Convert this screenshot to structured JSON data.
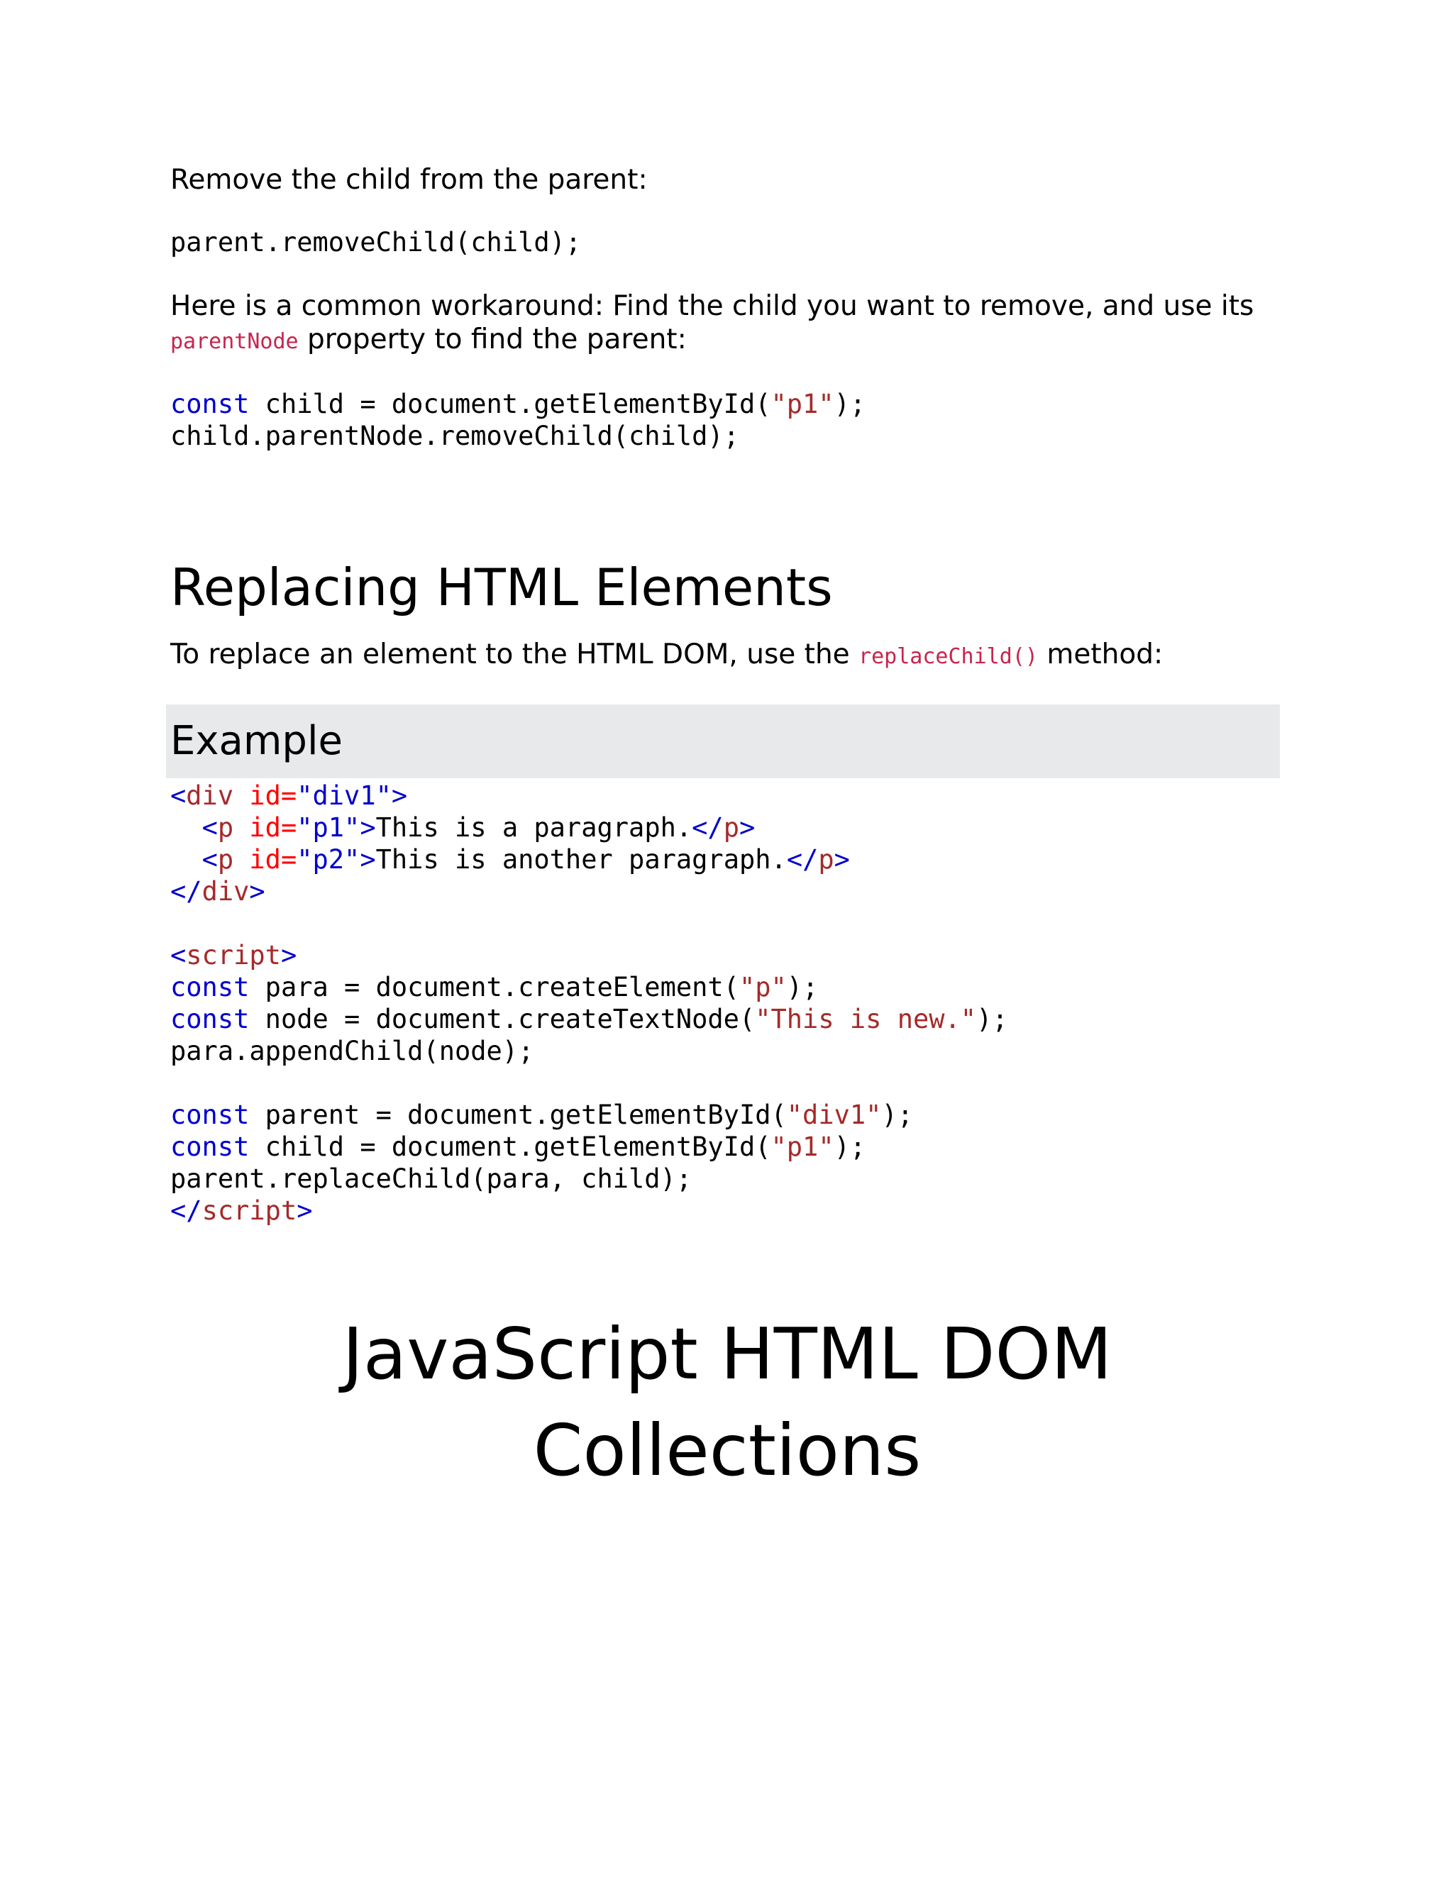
{
  "intro": {
    "remove_text": "Remove the child from the parent:",
    "remove_code": "parent.removeChild(child);",
    "workaround_before": "Here is a common workaround: Find the child you want to remove, and use its ",
    "workaround_code": "parentNode",
    "workaround_after": " property to find the parent:",
    "snippet": {
      "line1_kw": "const",
      "line1_mid": " child = document.getElementById(",
      "line1_str": "\"p1\"",
      "line1_end": ");",
      "line2": "child.parentNode.removeChild(child);"
    }
  },
  "section": {
    "heading": "Replacing HTML Elements",
    "desc_before": "To replace an element to the HTML DOM, use the ",
    "desc_code": "replaceChild()",
    "desc_after": " method:"
  },
  "example": {
    "title": "Example",
    "html_lines": [
      {
        "indent": "",
        "open": "<",
        "tag": "div",
        "attr": " id=",
        "val": "\"div1\"",
        "close": ">",
        "text": "",
        "endtag": ""
      },
      {
        "indent": "  ",
        "open": "<",
        "tag": "p",
        "attr": " id=",
        "val": "\"p1\"",
        "close": ">",
        "text": "This is a paragraph.",
        "endtag": "p"
      },
      {
        "indent": "  ",
        "open": "<",
        "tag": "p",
        "attr": " id=",
        "val": "\"p2\"",
        "close": ">",
        "text": "This is another paragraph.",
        "endtag": "p"
      },
      {
        "indent": "",
        "open": "</",
        "tag": "div",
        "attr": "",
        "val": "",
        "close": ">",
        "text": "",
        "endtag": ""
      }
    ],
    "script_open": "script",
    "script_lines": [
      {
        "kw": "const",
        "mid": " para = document.createElement(",
        "str": "\"p\"",
        "end": ");"
      },
      {
        "kw": "const",
        "mid": " node = document.createTextNode(",
        "str": "\"This is new.\"",
        "end": ");"
      },
      {
        "kw": "",
        "mid": "para.appendChild(node);",
        "str": "",
        "end": ""
      },
      {
        "kw": "",
        "mid": "",
        "str": "",
        "end": ""
      },
      {
        "kw": "const",
        "mid": " parent = document.getElementById(",
        "str": "\"div1\"",
        "end": ");"
      },
      {
        "kw": "const",
        "mid": " child = document.getElementById(",
        "str": "\"p1\"",
        "end": ");"
      },
      {
        "kw": "",
        "mid": "parent.replaceChild(para, child);",
        "str": "",
        "end": ""
      }
    ],
    "script_close": "script"
  },
  "chapter": {
    "title_line1": "JavaScript HTML DOM",
    "title_line2": "Collections"
  }
}
